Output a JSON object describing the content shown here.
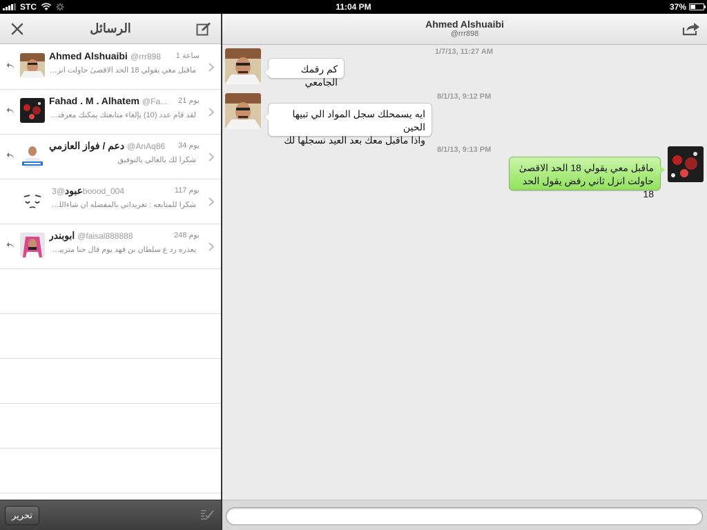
{
  "status_bar": {
    "carrier": "STC",
    "time": "11:04 PM",
    "battery": "37%",
    "battery_level": 0.37
  },
  "sidebar": {
    "title": "الرسائل",
    "close_icon": "close-icon",
    "compose_icon": "compose-icon",
    "edit_label": "تحرير",
    "conversations": [
      {
        "name": "Ahmed Alshuaibi",
        "handle": "@rrr898",
        "time": "1 ساعة",
        "snippet": "ماقبل معي يقولي 18 الحد الاقصىٰ حاولت انزل...",
        "replied": true
      },
      {
        "name": "Fahad . M . Alhatem",
        "handle": "@Fa...",
        "time": "21 يوم",
        "snippet": "لقد قام عدد (10) بإلغاء متابعتك يمكنك معرفتهم...",
        "replied": true
      },
      {
        "name": "دعم / فواز العازمي",
        "handle": "@AnAq86",
        "time": "34 يوم",
        "snippet": "شكرا لك يالغالي بالتوفيق",
        "replied": true
      },
      {
        "name": "عبود",
        "handle": "@3boood_004",
        "time": "117 يوم",
        "snippet": "شكرا للمتابعه : تغريداتي بالمفضله ان شاءالله تعج...",
        "replied": false
      },
      {
        "name": "ابوبندر",
        "handle": "@faisal888888",
        "time": "248 يوم",
        "snippet": "يعذره رد ع سلطان بن فهد يوم قال حنا متربين وا...",
        "replied": true
      }
    ]
  },
  "conversation": {
    "title": "Ahmed Alshuaibi",
    "subtitle": "@rrr898",
    "share_icon": "share-icon",
    "input_placeholder": "",
    "messages": [
      {
        "timestamp": "1/7/13, 11:27 AM",
        "text": "كم رقمك الجامعي",
        "direction": "incoming"
      },
      {
        "timestamp": "8/1/13, 9:12 PM",
        "text": "ايه يسمحلك سجل المواد الي تبيها الحين\nواذا ماقبل معك بعد العيد نسجلها لك",
        "direction": "incoming"
      },
      {
        "timestamp": "8/1/13, 9:13 PM",
        "text": "ماقبل معي يقولي 18 الحد الاقصىٰ\nحاولت انزل ثاني رفض يقول الحد 18",
        "direction": "outgoing"
      }
    ]
  },
  "colors": {
    "outgoing_bubble": "#a7ea7b",
    "incoming_bubble": "#ffffff",
    "chat_background": "#ebebeb"
  }
}
